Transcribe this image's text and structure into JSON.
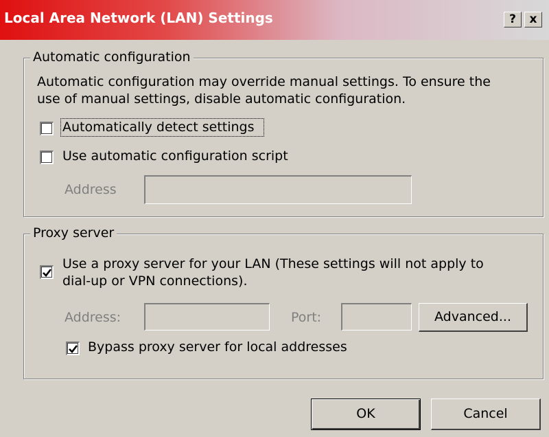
{
  "window": {
    "title": "Local Area Network (LAN) Settings",
    "help_button": "?",
    "close_button": "x"
  },
  "auto_config": {
    "legend": "Automatic configuration",
    "description_line1": "Automatic configuration may override manual settings.  To ensure the",
    "description_line2": "use of manual settings, disable automatic configuration.",
    "detect_settings": {
      "label": "Automatically detect settings",
      "checked": false
    },
    "config_script": {
      "label": "Use automatic configuration script",
      "checked": false
    },
    "address_label": "Address",
    "address_value": ""
  },
  "proxy": {
    "legend": "Proxy server",
    "use_proxy": {
      "label_line1": "Use a proxy server for your LAN (These settings will not apply to",
      "label_line2": "dial-up or VPN connections).",
      "checked": true
    },
    "address_label": "Address:",
    "address_value": "",
    "port_label": "Port:",
    "port_value": "",
    "advanced_button": "Advanced...",
    "bypass_local": {
      "label": "Bypass proxy server for local addresses",
      "checked": true
    }
  },
  "footer": {
    "ok_button": "OK",
    "cancel_button": "Cancel"
  },
  "colors": {
    "title_gradient_start": "#e01010",
    "dialog_background": "#d4d0c8",
    "disabled_text": "#7f7f7f"
  }
}
